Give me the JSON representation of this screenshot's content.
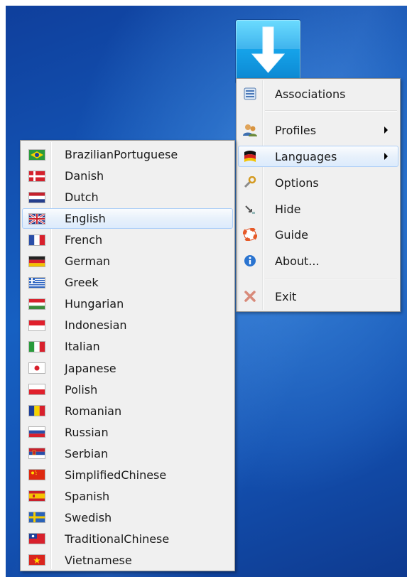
{
  "app": {
    "icon": "download-arrow-icon"
  },
  "main_menu": {
    "items": [
      {
        "label": "Associations",
        "icon": "associations-icon"
      },
      {
        "label": "Profiles",
        "icon": "profiles-icon",
        "submenu": true
      },
      {
        "label": "Languages",
        "icon": "languages-icon",
        "submenu": true,
        "highlighted": true
      },
      {
        "label": "Options",
        "icon": "options-icon"
      },
      {
        "label": "Hide",
        "icon": "hide-icon"
      },
      {
        "label": "Guide",
        "icon": "guide-icon"
      },
      {
        "label": "About...",
        "icon": "about-icon"
      },
      {
        "label": "Exit",
        "icon": "exit-icon"
      }
    ]
  },
  "language_menu": {
    "selected": "English",
    "items": [
      {
        "label": "BrazilianPortuguese",
        "flag": "brazil"
      },
      {
        "label": "Danish",
        "flag": "denmark"
      },
      {
        "label": "Dutch",
        "flag": "netherlands"
      },
      {
        "label": "English",
        "flag": "uk"
      },
      {
        "label": "French",
        "flag": "france"
      },
      {
        "label": "German",
        "flag": "germany"
      },
      {
        "label": "Greek",
        "flag": "greece"
      },
      {
        "label": "Hungarian",
        "flag": "hungary"
      },
      {
        "label": "Indonesian",
        "flag": "indonesia"
      },
      {
        "label": "Italian",
        "flag": "italy"
      },
      {
        "label": "Japanese",
        "flag": "japan"
      },
      {
        "label": "Polish",
        "flag": "poland"
      },
      {
        "label": "Romanian",
        "flag": "romania"
      },
      {
        "label": "Russian",
        "flag": "russia"
      },
      {
        "label": "Serbian",
        "flag": "serbia"
      },
      {
        "label": "SimplifiedChinese",
        "flag": "china"
      },
      {
        "label": "Spanish",
        "flag": "spain"
      },
      {
        "label": "Swedish",
        "flag": "sweden"
      },
      {
        "label": "TraditionalChinese",
        "flag": "taiwan"
      },
      {
        "label": "Vietnamese",
        "flag": "vietnam"
      }
    ]
  },
  "colors": {
    "highlight_border": "#aecff7",
    "menu_bg": "#f0f0f0",
    "desktop": "#1660c2"
  }
}
